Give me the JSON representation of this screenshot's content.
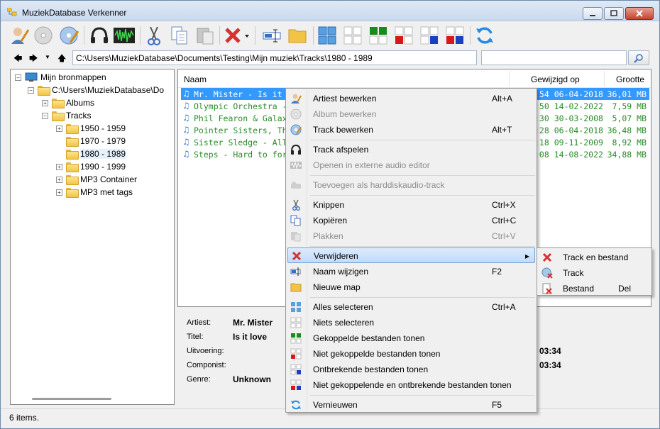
{
  "window": {
    "title": "MuziekDatabase Verkenner"
  },
  "toolbar": {
    "icons": [
      "edit-artist-icon",
      "cd-icon",
      "edit-track-icon",
      "headphones-icon",
      "audio-wave-icon",
      "scissors-icon",
      "copy-icon",
      "paste-icon",
      "delete-icon",
      "rename-icon",
      "new-folder-icon",
      "select-all-icon",
      "select-none-icon",
      "show-linked-icon",
      "show-unlinked-icon",
      "show-missing-icon",
      "show-unlinked-missing-icon",
      "refresh-icon"
    ]
  },
  "address": {
    "path": "C:\\Users\\MuziekDatabase\\Documents\\Testing\\Mijn muziek\\Tracks\\1980 - 1989"
  },
  "tree": {
    "root": "Mijn bronmappen",
    "path": "C:\\Users\\MuziekDatabase\\Do",
    "albums": "Albums",
    "tracks": "Tracks",
    "children": [
      "1950 - 1959",
      "1970 - 1979",
      "1980 - 1989",
      "1990 - 1999",
      "MP3 Container",
      "MP3 met tags"
    ]
  },
  "list": {
    "headers": {
      "name": "Naam",
      "modified": "Gewijzigd op",
      "size": "Grootte"
    },
    "rows": [
      {
        "name": "Mr. Mister - Is it love -",
        "date": ":54 06-04-2018",
        "size": "36,01 MB"
      },
      {
        "name": "Olympic Orchestra - Re",
        "date": ":50 14-02-2022",
        "size": "7,59 MB"
      },
      {
        "name": "Phil Fearon & Galaxy -",
        "date": ":30 30-03-2008",
        "size": "5,07 MB"
      },
      {
        "name": "Pointer Sisters, The - H",
        "date": ":28 06-04-2018",
        "size": "36,48 MB"
      },
      {
        "name": "Sister Sledge - All Ame",
        "date": ":18 09-11-2009",
        "size": "8,92 MB"
      },
      {
        "name": "Steps - Hard to forget",
        "date": ":08 14-08-2022",
        "size": "34,88 MB"
      }
    ]
  },
  "details": {
    "artist_label": "Artiest:",
    "artist": "Mr. Mister",
    "title_label": "Titel:",
    "title": "Is it love",
    "performance_label": "Uitvoering:",
    "composer_label": "Componist:",
    "genre_label": "Genre:",
    "genre": "Unknown",
    "duration1": "03:34",
    "duration2": "03:34"
  },
  "status": {
    "text": "6 items."
  },
  "context_menu": {
    "items": [
      {
        "label": "Artiest bewerken",
        "shortcut": "Alt+A"
      },
      {
        "label": "Album bewerken",
        "shortcut": ""
      },
      {
        "label": "Track bewerken",
        "shortcut": "Alt+T"
      },
      {
        "label": "Track afspelen",
        "shortcut": ""
      },
      {
        "label": "Openen in externe audio editor",
        "shortcut": ""
      },
      {
        "label": "Toevoegen als harddiskaudio-track",
        "shortcut": ""
      },
      {
        "label": "Knippen",
        "shortcut": "Ctrl+X"
      },
      {
        "label": "Kopiëren",
        "shortcut": "Ctrl+C"
      },
      {
        "label": "Plakken",
        "shortcut": "Ctrl+V"
      },
      {
        "label": "Verwijderen",
        "shortcut": ""
      },
      {
        "label": "Naam wijzigen",
        "shortcut": "F2"
      },
      {
        "label": "Nieuwe map",
        "shortcut": ""
      },
      {
        "label": "Alles selecteren",
        "shortcut": "Ctrl+A"
      },
      {
        "label": "Niets selecteren",
        "shortcut": ""
      },
      {
        "label": "Gekoppelde bestanden tonen",
        "shortcut": ""
      },
      {
        "label": "Niet gekoppelde bestanden tonen",
        "shortcut": ""
      },
      {
        "label": "Ontbrekende bestanden tonen",
        "shortcut": ""
      },
      {
        "label": "Niet gekoppelende en ontbrekende bestanden tonen",
        "shortcut": ""
      },
      {
        "label": "Vernieuwen",
        "shortcut": "F5"
      }
    ]
  },
  "submenu": {
    "items": [
      {
        "label": "Track en bestand",
        "shortcut": ""
      },
      {
        "label": "Track",
        "shortcut": ""
      },
      {
        "label": "Bestand",
        "shortcut": "Del"
      }
    ]
  },
  "colors": {
    "selection": "#3399ff",
    "file_text": "#2a8a2a",
    "menu_highlight": "#c1dbfc"
  }
}
